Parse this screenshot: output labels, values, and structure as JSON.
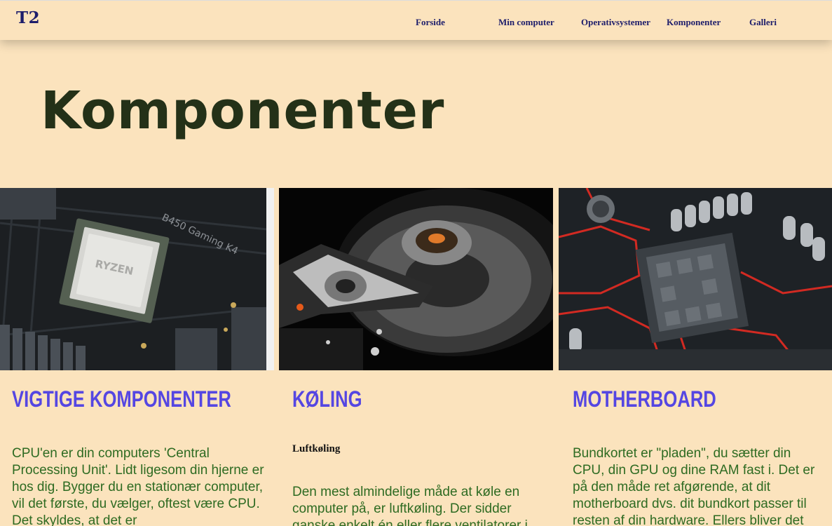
{
  "navbar": {
    "logo": "T2",
    "items": [
      {
        "label": "Forside"
      },
      {
        "label": "Min computer"
      },
      {
        "label": "Operativsystemer"
      },
      {
        "label": "Komponenter"
      },
      {
        "label": "Galleri"
      }
    ]
  },
  "page": {
    "title": "Komponenter"
  },
  "cards": [
    {
      "heading": "Vigtige komponenter",
      "image_icon": "cpu-motherboard-photo",
      "text": "CPU'en er din computers 'Central Processing Unit'. Lidt ligesom din hjerne er hos dig. Bygger du en stationær computer, vil det første, du vælger, oftest være CPU. Det skyldes, at det er"
    },
    {
      "heading": "Køling",
      "image_icon": "hard-drive-photo",
      "subheading": "Luftkøling",
      "text": "Den mest almindelige måde at køle en computer på, er luftkøling. Der sidder ganske enkelt én eller flere ventilatorer i"
    },
    {
      "heading": "Motherboard",
      "image_icon": "motherboard-socket-photo",
      "text": "Bundkortet er \"pladen\", du sætter din CPU, din GPU og dine RAM fast i. Det er på den måde ret afgørende, at dit motherboard dvs. dit bundkort passer til resten af din hardware. Ellers bliver det"
    }
  ],
  "colors": {
    "background": "#fbe3bd",
    "nav_text": "#1d1d6b",
    "title": "#243118",
    "heading": "#5546e2",
    "body_text": "#2e6b22"
  }
}
